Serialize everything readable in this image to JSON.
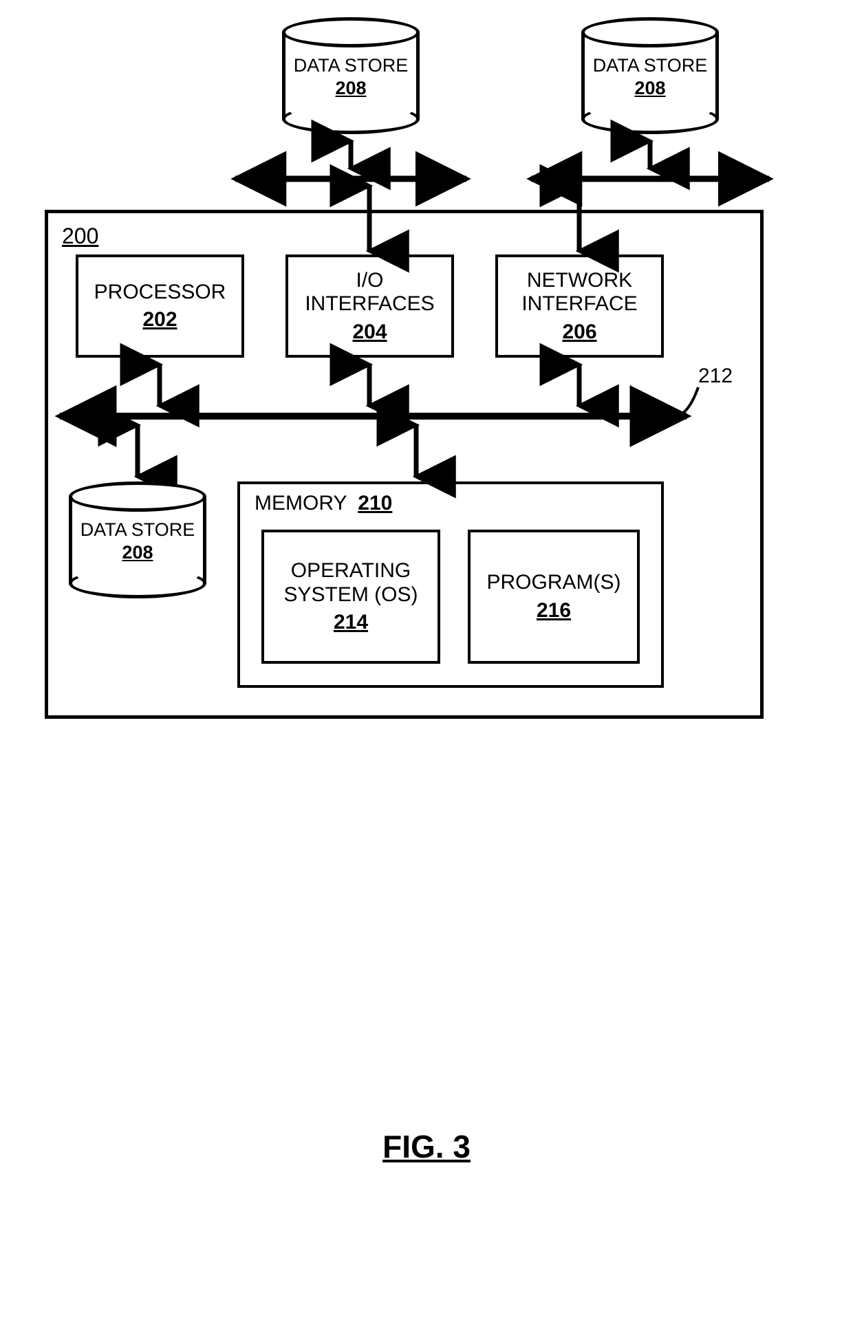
{
  "figure_label": "FIG. 3",
  "system_ref": "200",
  "bus_ref": "212",
  "data_store": {
    "label": "DATA STORE",
    "ref": "208"
  },
  "processor": {
    "label": "PROCESSOR",
    "ref": "202"
  },
  "io": {
    "label": "I/O INTERFACES",
    "ref": "204"
  },
  "net": {
    "label": "NETWORK INTERFACE",
    "ref": "206"
  },
  "memory": {
    "title": "MEMORY",
    "ref": "210"
  },
  "os": {
    "label": "OPERATING SYSTEM (OS)",
    "ref": "214"
  },
  "programs": {
    "label": "PROGRAM(S)",
    "ref": "216"
  }
}
